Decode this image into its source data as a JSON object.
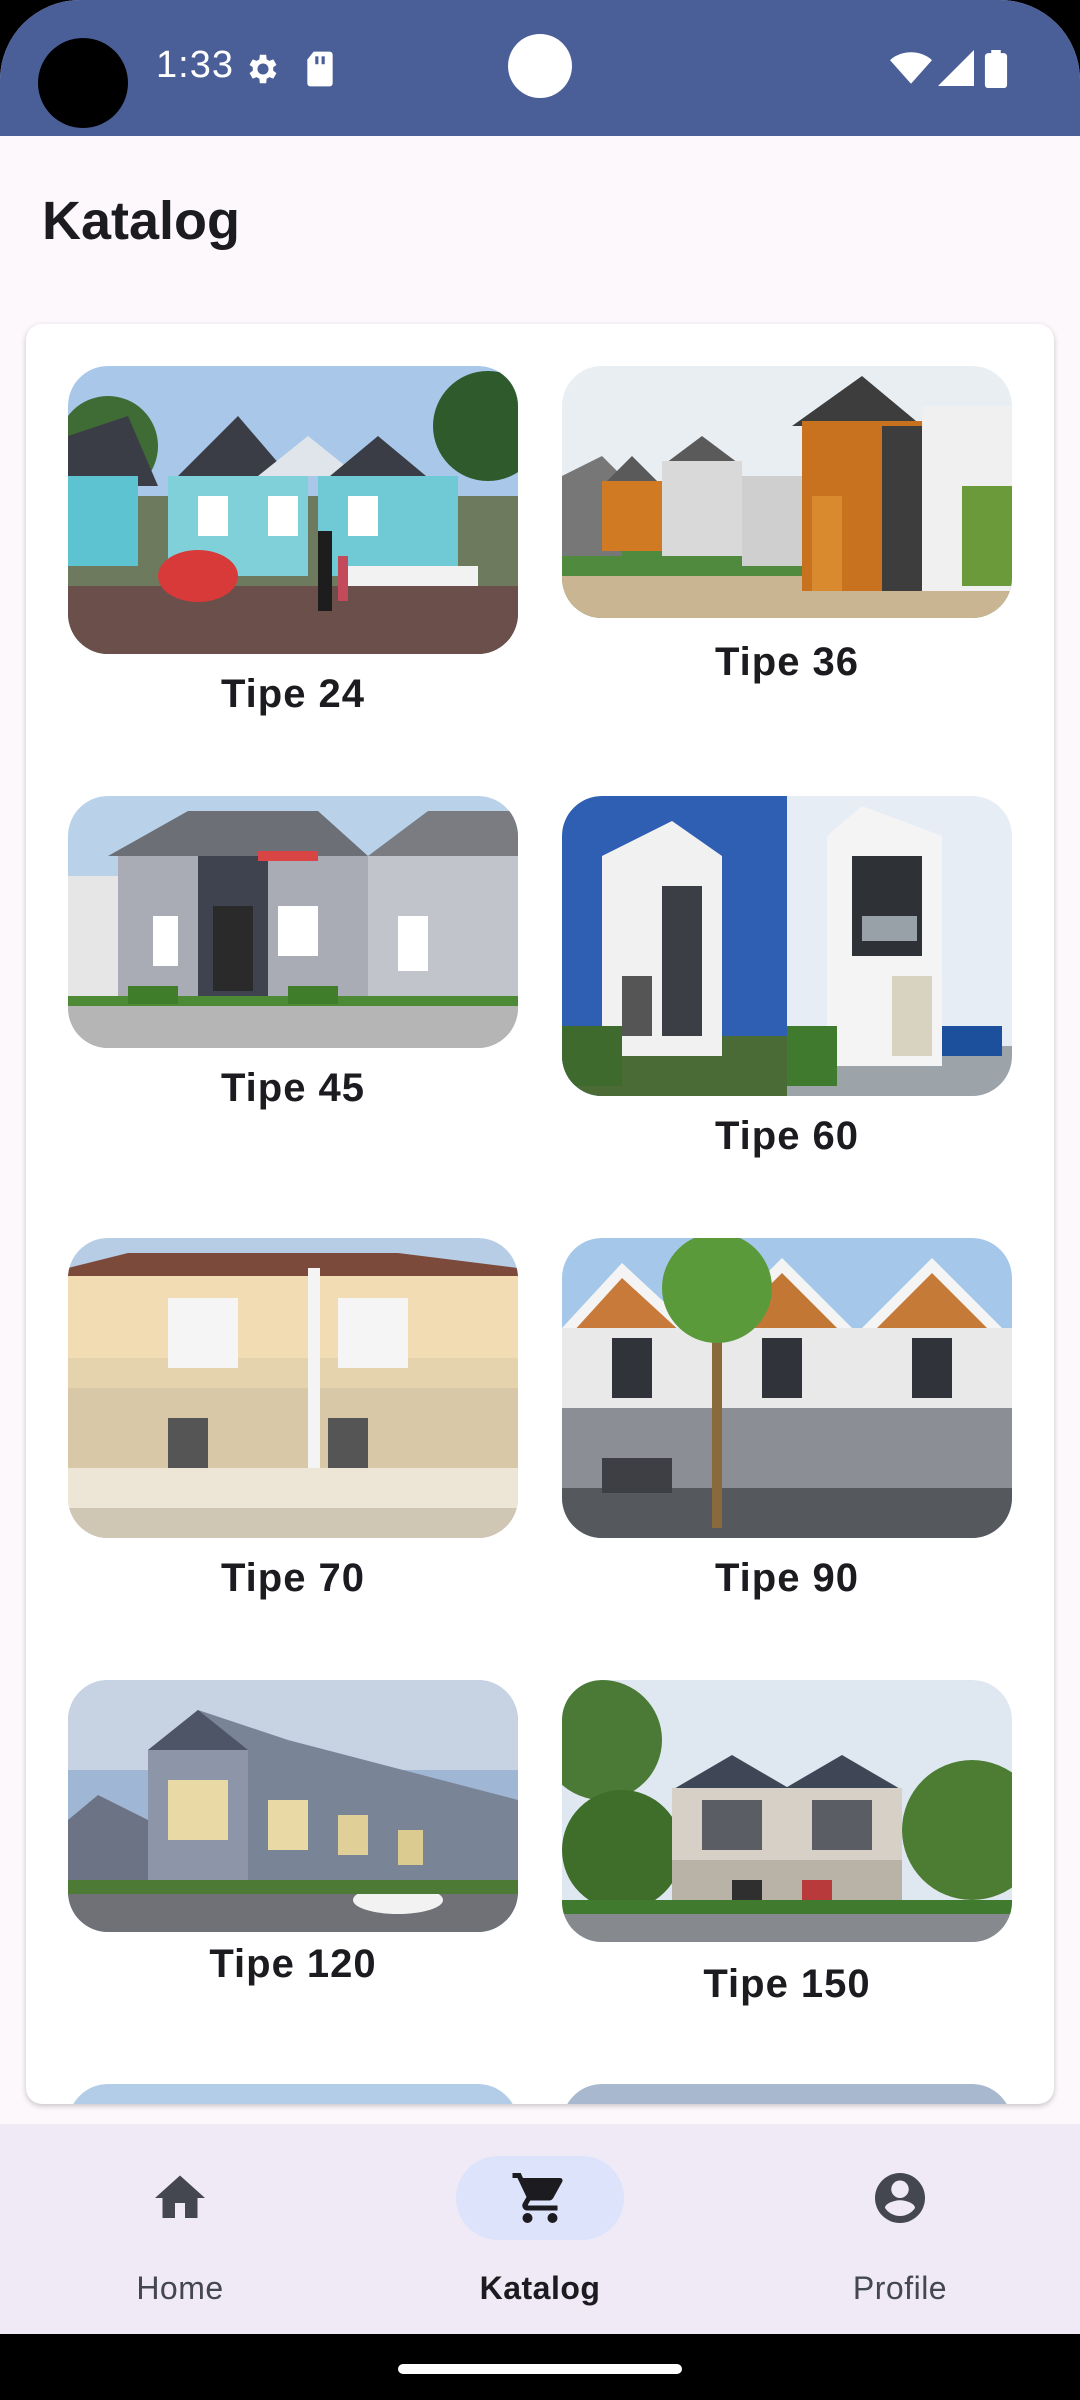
{
  "status_bar": {
    "time": "1:33",
    "icons": [
      "settings-icon",
      "sd-card-icon",
      "wifi-icon",
      "signal-icon",
      "battery-icon"
    ],
    "color": "#4a5e97"
  },
  "page": {
    "title": "Katalog"
  },
  "catalog": {
    "items": [
      {
        "label": "Tipe 24"
      },
      {
        "label": "Tipe 36"
      },
      {
        "label": "Tipe 45"
      },
      {
        "label": "Tipe 60"
      },
      {
        "label": "Tipe 70"
      },
      {
        "label": "Tipe 90"
      },
      {
        "label": "Tipe 120"
      },
      {
        "label": "Tipe 150"
      }
    ]
  },
  "bottom_nav": {
    "items": [
      {
        "label": "Home",
        "icon": "home-icon",
        "active": false
      },
      {
        "label": "Katalog",
        "icon": "cart-icon",
        "active": true
      },
      {
        "label": "Profile",
        "icon": "account-circle-icon",
        "active": false
      }
    ],
    "active_color": "#dde3fb"
  }
}
